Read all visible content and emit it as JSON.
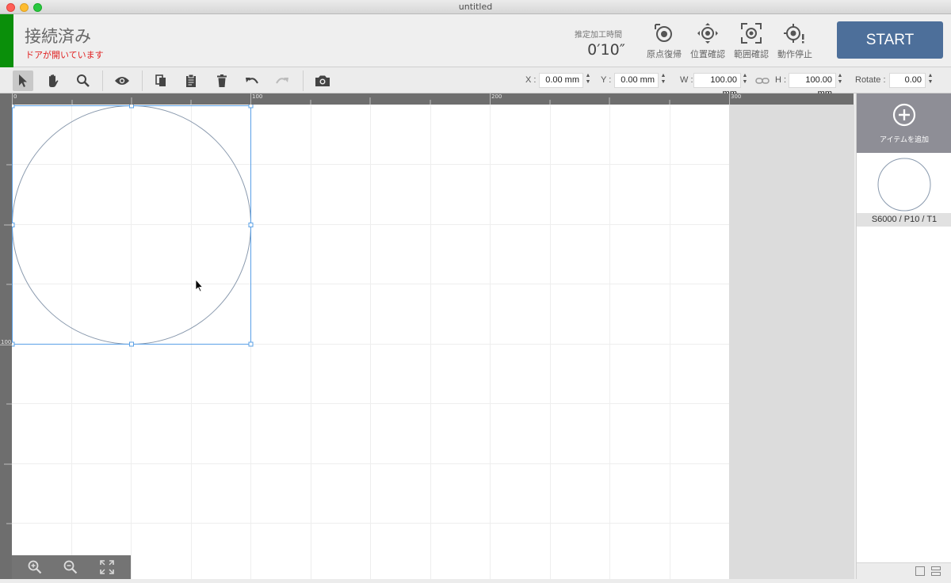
{
  "window": {
    "title": "untitled"
  },
  "header": {
    "connection_status": "接続済み",
    "door_warning": "ドアが開いています",
    "estimated_time_label": "推定加工時間",
    "estimated_time_value": "0′10″",
    "actions": [
      {
        "label": "原点復帰",
        "icon": "home-target-icon"
      },
      {
        "label": "位置確認",
        "icon": "position-check-icon"
      },
      {
        "label": "範囲確認",
        "icon": "range-check-icon"
      },
      {
        "label": "動作停止",
        "icon": "stop-operation-icon"
      }
    ],
    "start_label": "START",
    "colors": {
      "connected": "#0a8f0a",
      "warning": "#e02020",
      "start": "#4d6f9a"
    }
  },
  "toolbar": {
    "tools": [
      "select-arrow-icon",
      "hand-pan-icon",
      "magnifier-icon",
      "eye-icon",
      "copy-icon",
      "paste-icon",
      "trash-icon",
      "undo-icon",
      "redo-icon",
      "camera-icon"
    ],
    "x_label": "X :",
    "x_value": "0.00 mm",
    "y_label": "Y :",
    "y_value": "0.00 mm",
    "w_label": "W :",
    "w_value": "100.00 mm",
    "h_label": "H :",
    "h_value": "100.00 mm",
    "rotate_label": "Rotate :",
    "rotate_value": "0.00"
  },
  "rulers": {
    "top": [
      "0",
      "100",
      "200",
      "300"
    ],
    "left": [
      "100"
    ]
  },
  "panel": {
    "add_item_label": "アイテムを追加",
    "items": [
      {
        "label": "S6000 / P10 / T1",
        "shape": "circle"
      }
    ]
  }
}
